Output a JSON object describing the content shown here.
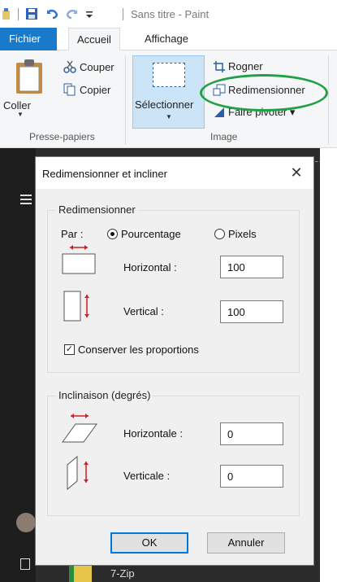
{
  "window": {
    "title": "Sans titre - Paint"
  },
  "tabs": [
    {
      "label": "Fichier"
    },
    {
      "label": "Accueil"
    },
    {
      "label": "Affichage"
    }
  ],
  "ribbon": {
    "clipboard": {
      "paste": "Coller",
      "cut": "Couper",
      "copy": "Copier",
      "group_label": "Presse-papiers"
    },
    "image": {
      "select": "Sélectionner",
      "crop": "Rogner",
      "resize": "Redimensionner",
      "rotate": "Faire pivoter",
      "group_label": "Image"
    }
  },
  "dialog": {
    "title": "Redimensionner et incliner",
    "resize": {
      "legend": "Redimensionner",
      "by_label": "Par :",
      "option_percent": "Pourcentage",
      "option_pixels": "Pixels",
      "selected": "Pourcentage",
      "horizontal_label": "Horizontal :",
      "horizontal_value": "100",
      "vertical_label": "Vertical :",
      "vertical_value": "100",
      "keep_ratio_label": "Conserver les proportions",
      "keep_ratio_checked": true
    },
    "skew": {
      "legend": "Inclinaison (degrés)",
      "horizontal_label": "Horizontale :",
      "horizontal_value": "0",
      "vertical_label": "Verticale :",
      "vertical_value": "0"
    },
    "ok_label": "OK",
    "cancel_label": "Annuler"
  },
  "background": {
    "item_label": "7-Zip"
  },
  "colors": {
    "accent": "#1979ca",
    "highlight_oval": "#21a046",
    "select_bg": "#cce4f7",
    "dialog_bg": "#f0f0f0",
    "arrow_red": "#d01f1f"
  }
}
